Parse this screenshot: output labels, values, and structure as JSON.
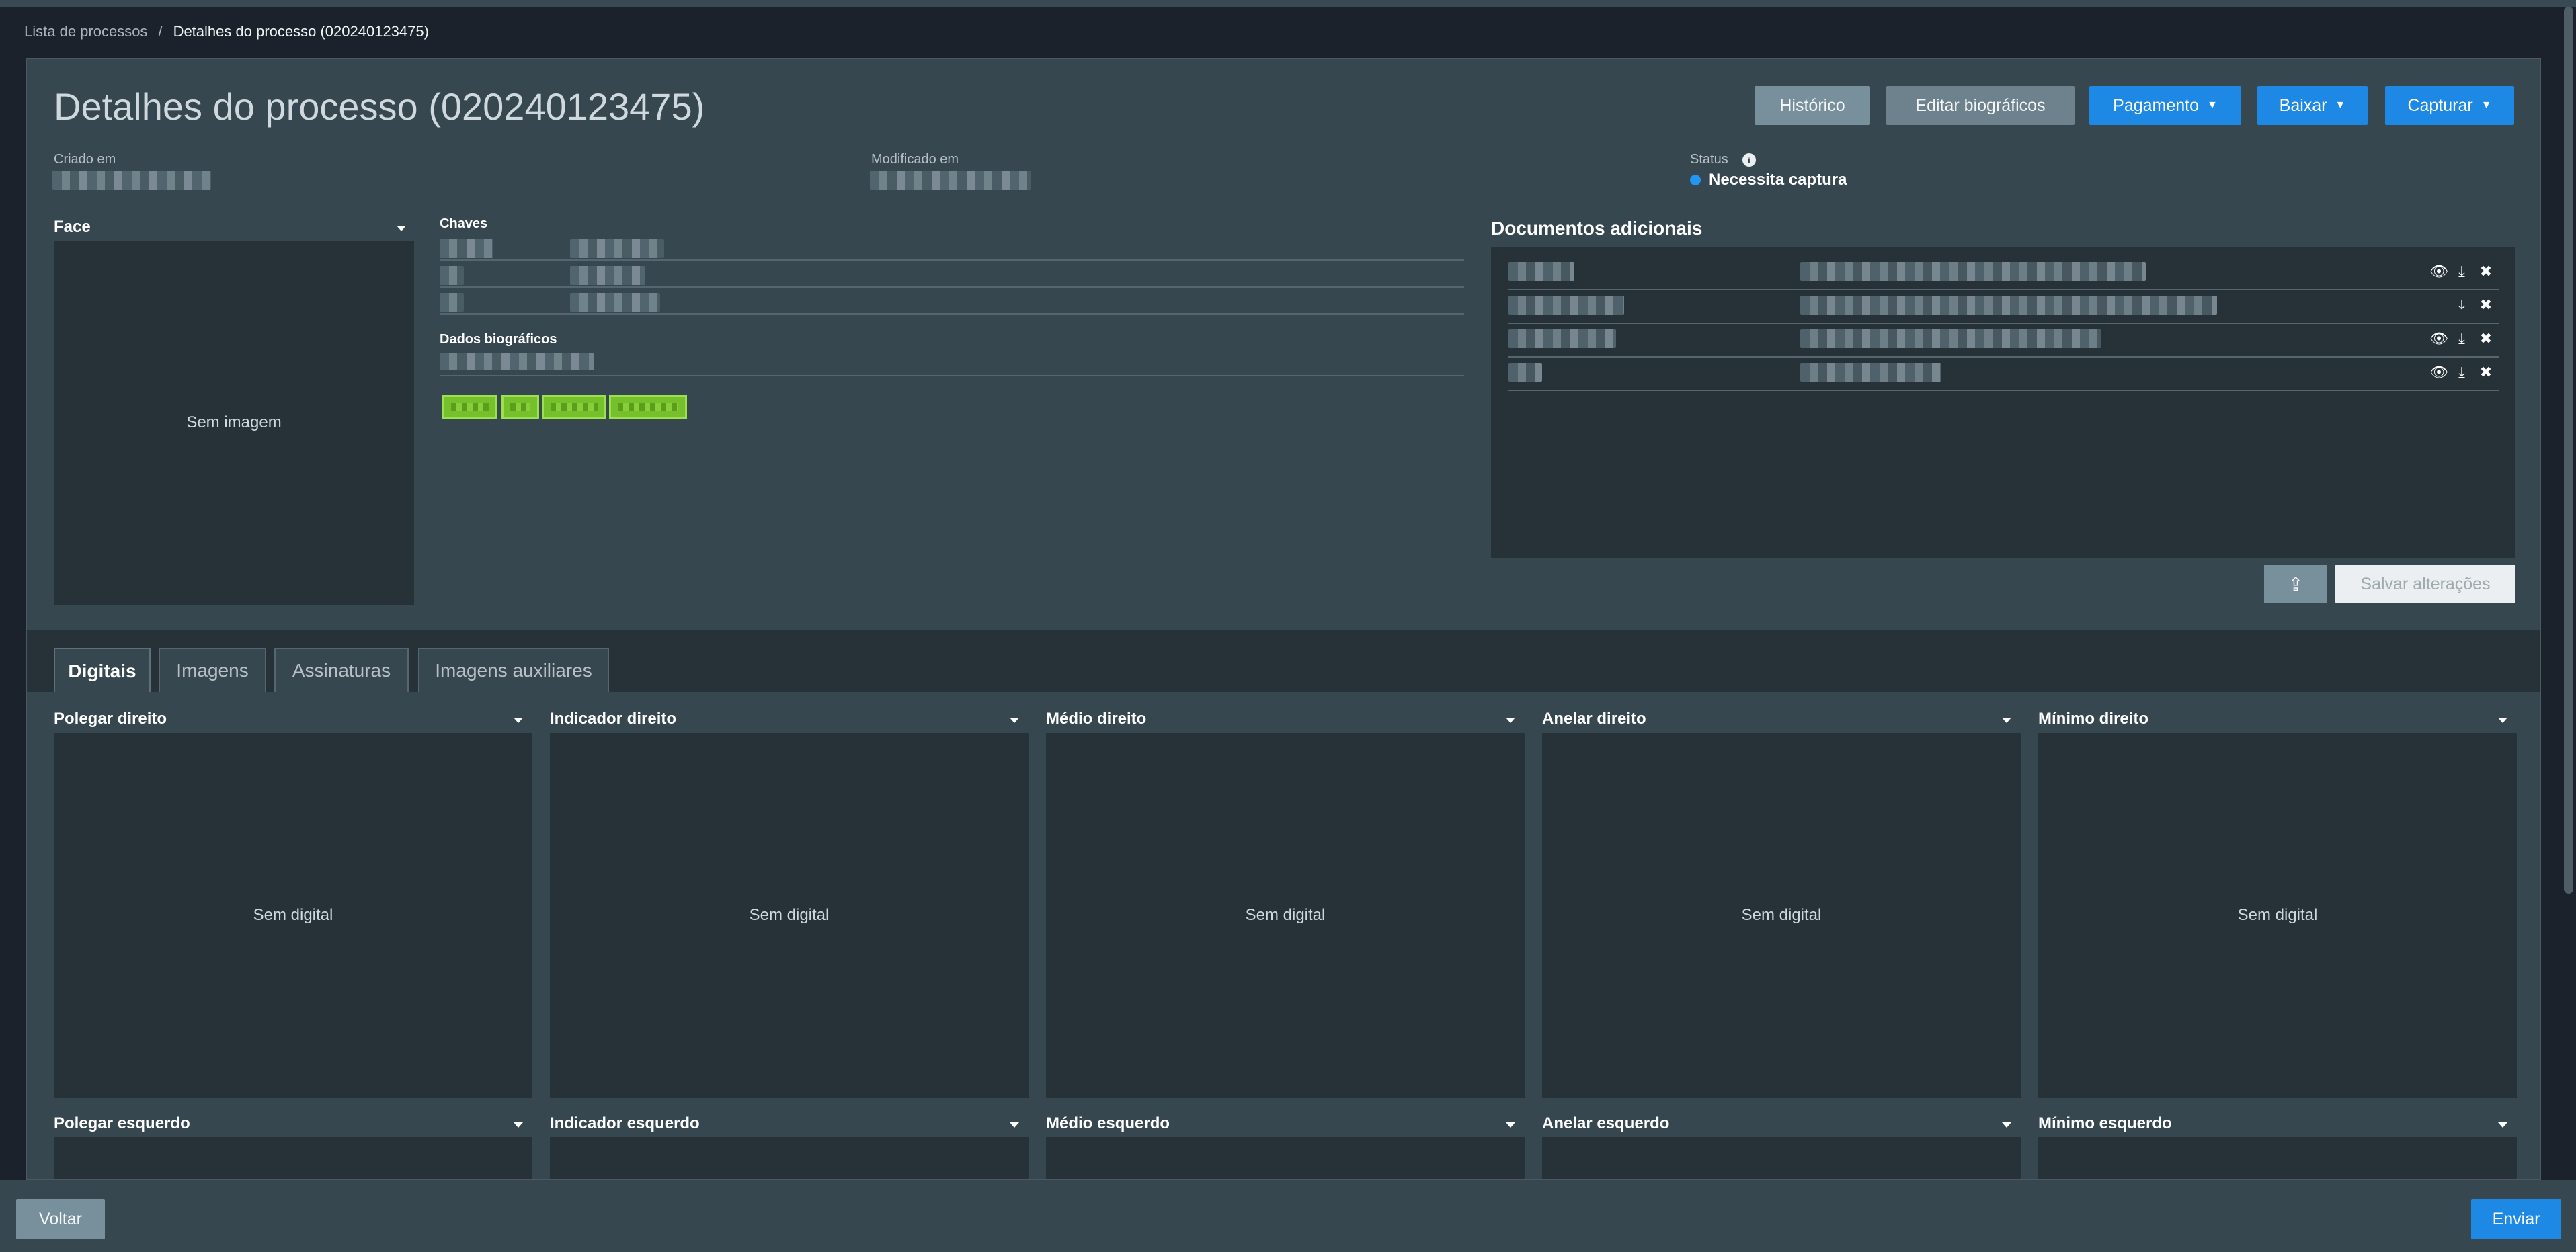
{
  "breadcrumb": {
    "parent": "Lista de processos",
    "separator": "/",
    "current": "Detalhes do processo (020240123475)"
  },
  "page": {
    "title": "Detalhes do processo (020240123475)"
  },
  "actions": {
    "history": "Histórico",
    "edit_bio": "Editar biográficos",
    "payment": "Pagamento",
    "download": "Baixar",
    "capture": "Capturar"
  },
  "meta": {
    "created_label": "Criado em",
    "modified_label": "Modificado em",
    "status_label": "Status",
    "status_value": "Necessita captura",
    "status_color": "#2196f3"
  },
  "face": {
    "label": "Face",
    "placeholder": "Sem imagem"
  },
  "keys": {
    "label": "Chaves"
  },
  "bio": {
    "label": "Dados biográficos"
  },
  "documents": {
    "label": "Documentos adicionais",
    "save_label": "Salvar alterações"
  },
  "tabs": [
    {
      "label": "Digitais"
    },
    {
      "label": "Imagens"
    },
    {
      "label": "Assinaturas"
    },
    {
      "label": "Imagens auxiliares"
    }
  ],
  "fingers": {
    "placeholder": "Sem digital",
    "right": [
      "Polegar direito",
      "Indicador direito",
      "Médio direito",
      "Anelar direito",
      "Mínimo direito"
    ],
    "left": [
      "Polegar esquerdo",
      "Indicador esquerdo",
      "Médio esquerdo",
      "Anelar esquerdo",
      "Mínimo esquerdo"
    ]
  },
  "footer": {
    "back": "Voltar",
    "send": "Enviar"
  },
  "colors": {
    "accent": "#1e88e5",
    "panel": "#37474f",
    "dark_panel": "#263238",
    "highlight_green": "#76c12b"
  }
}
